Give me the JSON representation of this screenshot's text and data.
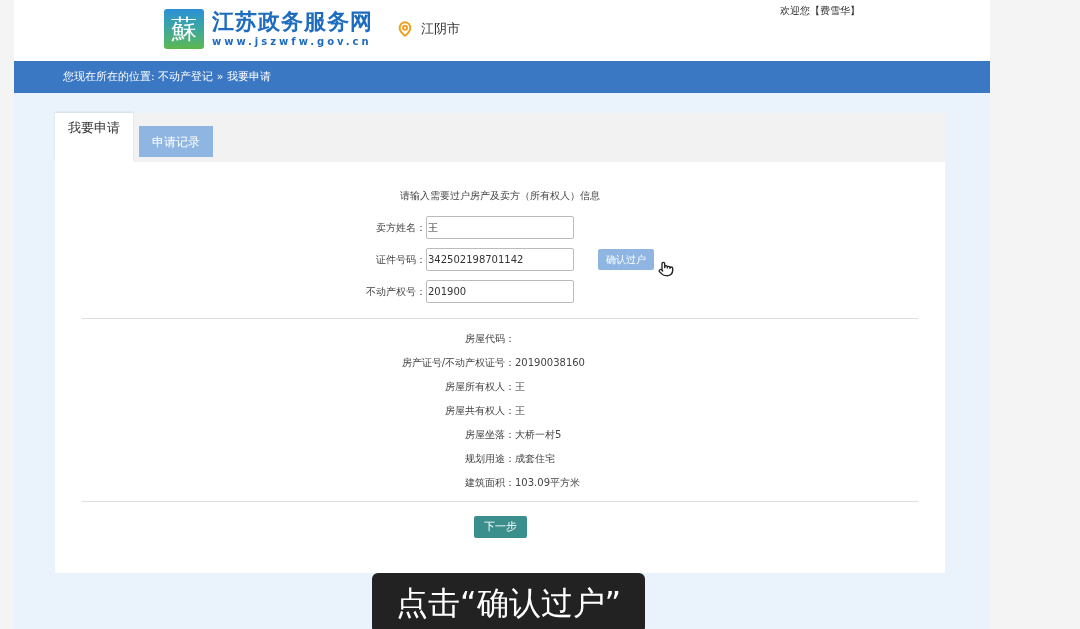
{
  "header": {
    "logo_char": "蘇",
    "site_title": "江苏政务服务网",
    "site_url": "www.jszwfw.gov.cn",
    "city": "江阴市",
    "welcome": "欢迎您【费雪华】"
  },
  "breadcrumb": "您现在所在的位置: 不动产登记 » 我要申请",
  "tabs": [
    {
      "label": "我要申请",
      "selected": true
    },
    {
      "label": "申请记录",
      "selected": false
    }
  ],
  "form": {
    "intro": "请输入需要过户房产及卖方（所有权人）信息",
    "fields": [
      {
        "label": "卖方姓名：",
        "value": "王"
      },
      {
        "label": "证件号码：",
        "value": "342502198701142"
      },
      {
        "label": "不动产权号：",
        "value": "201900"
      }
    ],
    "confirm_button": "确认过户"
  },
  "details": [
    {
      "label": "房屋代码："
    },
    {
      "label": "房产证号/不动产权证号：",
      "value": "20190038160"
    },
    {
      "label": "房屋所有权人：",
      "value": "王"
    },
    {
      "label": "房屋共有权人：",
      "value": "王"
    },
    {
      "label": "房屋坐落：",
      "value": "大桥一村5"
    },
    {
      "label": "规划用途：",
      "value": "成套住宅"
    },
    {
      "label": "建筑面积：",
      "value": "103.09平方米"
    }
  ],
  "next_button": "下一步",
  "caption": "点击“确认过户”"
}
